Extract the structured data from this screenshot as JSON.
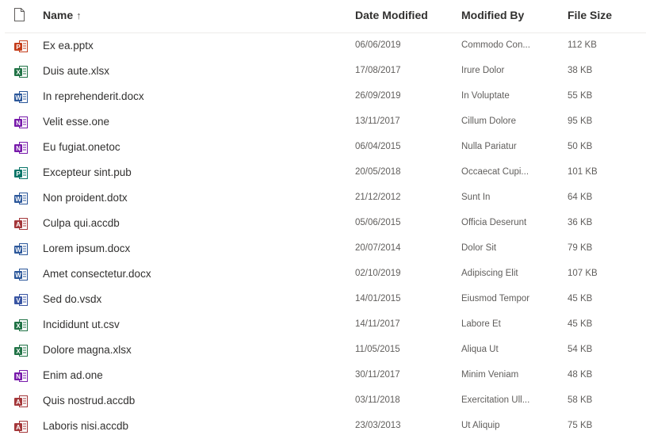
{
  "header": {
    "name_label": "Name",
    "sort_arrow": "↑",
    "date_label": "Date Modified",
    "modified_by_label": "Modified By",
    "size_label": "File Size",
    "file_type_icon": "document-outline-icon"
  },
  "colors": {
    "powerpoint": "#c43e1c",
    "excel": "#217346",
    "word": "#2b579a",
    "onenote": "#7719aa",
    "publisher": "#077568",
    "access": "#a4373a",
    "visio": "#3955a3"
  },
  "files": [
    {
      "name": "Ex ea.pptx",
      "date": "06/06/2019",
      "by": "Commodo Con...",
      "size": "112 KB",
      "app": "powerpoint",
      "letter": "P"
    },
    {
      "name": "Duis aute.xlsx",
      "date": "17/08/2017",
      "by": "Irure Dolor",
      "size": "38 KB",
      "app": "excel",
      "letter": "X"
    },
    {
      "name": "In reprehenderit.docx",
      "date": "26/09/2019",
      "by": "In Voluptate",
      "size": "55 KB",
      "app": "word",
      "letter": "W"
    },
    {
      "name": "Velit esse.one",
      "date": "13/11/2017",
      "by": "Cillum Dolore",
      "size": "95 KB",
      "app": "onenote",
      "letter": "N"
    },
    {
      "name": "Eu fugiat.onetoc",
      "date": "06/04/2015",
      "by": "Nulla Pariatur",
      "size": "50 KB",
      "app": "onenote",
      "letter": "N"
    },
    {
      "name": "Excepteur sint.pub",
      "date": "20/05/2018",
      "by": "Occaecat Cupi...",
      "size": "101 KB",
      "app": "publisher",
      "letter": "P"
    },
    {
      "name": "Non proident.dotx",
      "date": "21/12/2012",
      "by": "Sunt In",
      "size": "64 KB",
      "app": "word",
      "letter": "W"
    },
    {
      "name": "Culpa qui.accdb",
      "date": "05/06/2015",
      "by": "Officia Deserunt",
      "size": "36 KB",
      "app": "access",
      "letter": "A"
    },
    {
      "name": "Lorem ipsum.docx",
      "date": "20/07/2014",
      "by": "Dolor Sit",
      "size": "79 KB",
      "app": "word",
      "letter": "W"
    },
    {
      "name": "Amet consectetur.docx",
      "date": "02/10/2019",
      "by": "Adipiscing Elit",
      "size": "107 KB",
      "app": "word",
      "letter": "W"
    },
    {
      "name": "Sed do.vsdx",
      "date": "14/01/2015",
      "by": "Eiusmod Tempor",
      "size": "45 KB",
      "app": "visio",
      "letter": "V"
    },
    {
      "name": "Incididunt ut.csv",
      "date": "14/11/2017",
      "by": "Labore Et",
      "size": "45 KB",
      "app": "excel",
      "letter": "X"
    },
    {
      "name": "Dolore magna.xlsx",
      "date": "11/05/2015",
      "by": "Aliqua Ut",
      "size": "54 KB",
      "app": "excel",
      "letter": "X"
    },
    {
      "name": "Enim ad.one",
      "date": "30/11/2017",
      "by": "Minim Veniam",
      "size": "48 KB",
      "app": "onenote",
      "letter": "N"
    },
    {
      "name": "Quis nostrud.accdb",
      "date": "03/11/2018",
      "by": "Exercitation Ull...",
      "size": "58 KB",
      "app": "access",
      "letter": "A"
    },
    {
      "name": "Laboris nisi.accdb",
      "date": "23/03/2013",
      "by": "Ut Aliquip",
      "size": "75 KB",
      "app": "access",
      "letter": "A"
    }
  ]
}
